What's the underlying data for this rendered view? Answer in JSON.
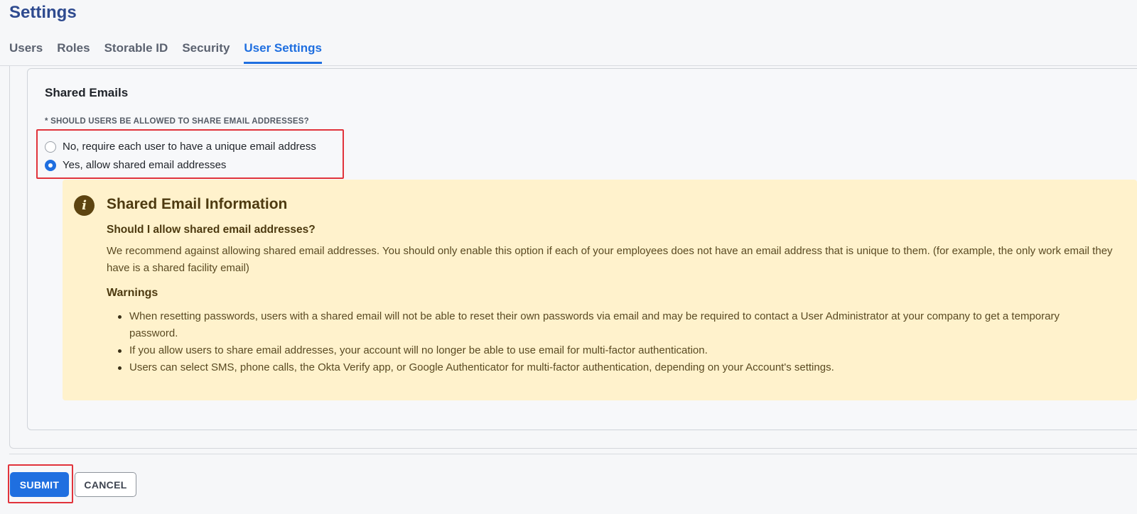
{
  "page": {
    "title": "Settings"
  },
  "tabs": [
    {
      "label": "Users",
      "active": false
    },
    {
      "label": "Roles",
      "active": false
    },
    {
      "label": "Storable ID",
      "active": false
    },
    {
      "label": "Security",
      "active": false
    },
    {
      "label": "User Settings",
      "active": true
    }
  ],
  "section": {
    "title": "Shared Emails",
    "question": "* SHOULD USERS BE ALLOWED TO SHARE EMAIL ADDRESSES?",
    "options": [
      {
        "label": "No, require each user to have a unique email address",
        "checked": false
      },
      {
        "label": "Yes, allow shared email addresses",
        "checked": true
      }
    ]
  },
  "info": {
    "icon": "info-icon",
    "icon_glyph": "i",
    "title": "Shared Email Information",
    "question": "Should I allow shared email addresses?",
    "text": "We recommend against allowing shared email addresses. You should only enable this option if each of your employees does not have an email address that is unique to them. (for example, the only work email they have is a shared facility email)",
    "warnings_title": "Warnings",
    "warnings": [
      "When resetting passwords, users with a shared email will not be able to reset their own passwords via email and may be required to contact a User Administrator at your company to get a temporary password.",
      "If you allow users to share email addresses, your account will no longer be able to use email for multi-factor authentication.",
      "Users can select SMS, phone calls, the Okta Verify app, or Google Authenticator for multi-factor authentication, depending on your Account's settings."
    ]
  },
  "actions": {
    "submit_label": "SUBMIT",
    "cancel_label": "CANCEL"
  },
  "colors": {
    "accent": "#1f6fe0",
    "title": "#2e4a8f",
    "highlight": "#e1333b",
    "info_bg": "#fff2cc"
  }
}
